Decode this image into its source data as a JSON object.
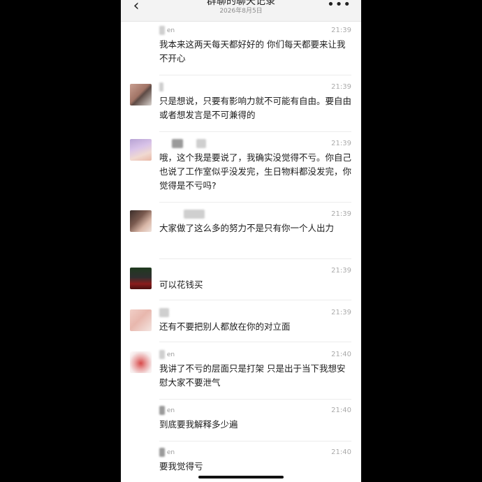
{
  "nav": {
    "back_icon": "chevron-left-icon",
    "title": "群聊的聊天记录",
    "date": "2026年8月5日",
    "more_icon": "more-dots-icon"
  },
  "messages": [
    {
      "name_suffix": "en",
      "time": "21:39",
      "text": "我本来这两天每天都好好的  你们每天都要来让我不开心"
    },
    {
      "name_suffix": "",
      "time": "21:39",
      "text": "只是想说，只要有影响力就不可能有自由。要自由或者想发言是不可兼得的"
    },
    {
      "name_suffix": "",
      "time": "21:39",
      "text": "哦，这个我是要说了，我确实没觉得不亏。你自己也说了工作室似乎没发完，生日物料都没发完，你觉得是不亏吗?"
    },
    {
      "name_suffix": "",
      "time": "21:39",
      "text": "大家做了这么多的努力不是只有你一个人出力"
    },
    {
      "name_suffix": "",
      "time": "21:39",
      "text": "可以花钱买"
    },
    {
      "name_suffix": "",
      "time": "21:39",
      "text": "还有不要把别人都放在你的对立面"
    },
    {
      "name_suffix": "en",
      "time": "21:40",
      "text": "我讲了不亏的层面只是打架  只是出于当下我想安慰大家不要泄气"
    },
    {
      "name_suffix": "en",
      "time": "21:40",
      "text": "到底要我解释多少遍"
    },
    {
      "name_suffix": "en",
      "time": "21:40",
      "text": "要我觉得亏"
    }
  ],
  "colors": {
    "screen_bg": "#ffffff",
    "nav_bg": "#f3f3f3",
    "outer_bg": "#000000",
    "text": "#1c1c1c",
    "muted": "#aaaaaa"
  }
}
